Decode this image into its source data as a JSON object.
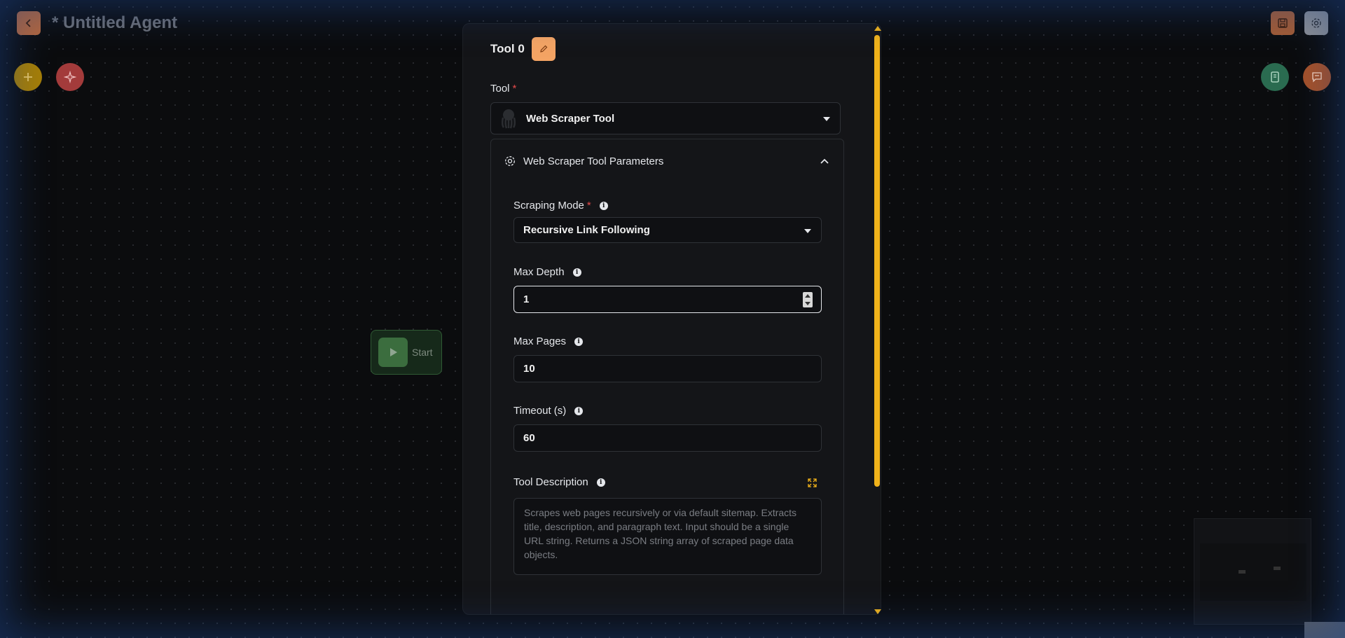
{
  "header": {
    "title": "* Untitled Agent"
  },
  "canvas": {
    "start_label": "Start"
  },
  "panel": {
    "title": "Tool 0",
    "tool_label": "Tool",
    "required_mark": "*",
    "selected_tool": "Web Scraper Tool",
    "params_title": "Web Scraper Tool Parameters",
    "fields": {
      "scraping_mode": {
        "label": "Scraping Mode",
        "value": "Recursive Link Following"
      },
      "max_depth": {
        "label": "Max Depth",
        "value": "1"
      },
      "max_pages": {
        "label": "Max Pages",
        "value": "10"
      },
      "timeout": {
        "label": "Timeout (s)",
        "value": "60"
      },
      "tool_description": {
        "label": "Tool Description",
        "placeholder": "Scrapes web pages recursively or via default sitemap. Extracts title, description, and paragraph text. Input should be a single URL string. Returns a JSON string array of scraped page data objects."
      }
    }
  },
  "colors": {
    "accent_orange": "#f4a464",
    "scrollbar": "#f0b21a",
    "start_green": "#3b6d3e"
  }
}
